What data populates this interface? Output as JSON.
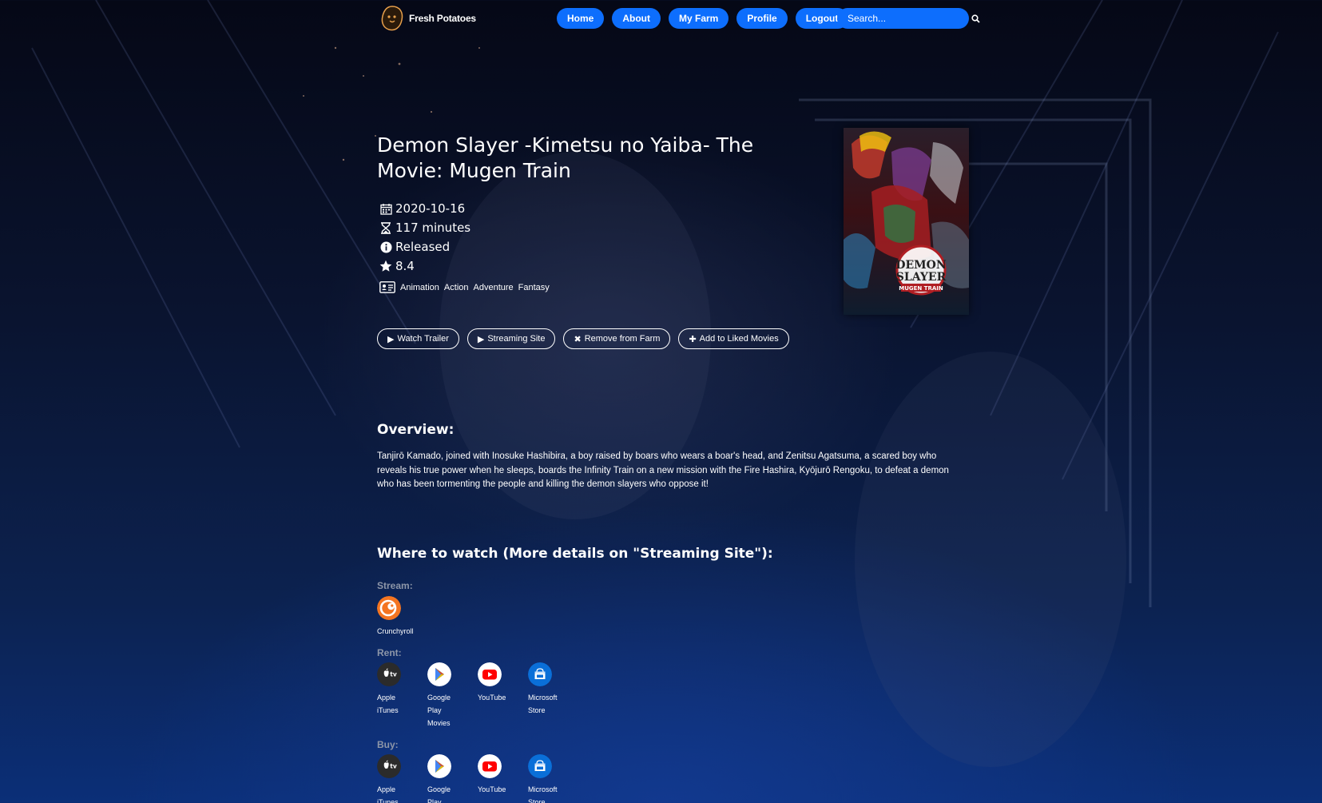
{
  "brand": {
    "name": "Fresh Potatoes",
    "icon": "potato-icon"
  },
  "nav": {
    "items": [
      "Home",
      "About",
      "My Farm",
      "Profile",
      "Logout"
    ],
    "search_placeholder": "Search..."
  },
  "movie": {
    "title": "Demon Slayer -Kimetsu no Yaiba- The Movie: Mugen Train",
    "release_date": "2020-10-16",
    "runtime": "117 minutes",
    "status": "Released",
    "rating": "8.4",
    "genres": [
      "Animation",
      "Action",
      "Adventure",
      "Fantasy"
    ],
    "poster": {
      "title_line1": "DEMON",
      "title_line2": "SLAYER",
      "subtitle": "MUGEN TRAIN"
    }
  },
  "actions": {
    "watch_trailer": "Watch Trailer",
    "streaming_site": "Streaming Site",
    "remove_from_farm": "Remove from Farm",
    "add_to_liked": "Add to Liked Movies"
  },
  "overview": {
    "heading": "Overview:",
    "text": "Tanjirō Kamado, joined with Inosuke Hashibira, a boy raised by boars who wears a boar's head, and Zenitsu Agatsuma, a scared boy who reveals his true power when he sleeps, boards the Infinity Train on a new mission with the Fire Hashira, Kyōjurō Rengoku, to defeat a demon who has been tormenting the people and killing the demon slayers who oppose it!"
  },
  "where_to_watch": {
    "heading": "Where to watch (More details on \"Streaming Site\"):",
    "stream_label": "Stream:",
    "stream": [
      {
        "name": "Crunchyroll",
        "icon": "crunchyroll-icon"
      }
    ],
    "rent_label": "Rent:",
    "rent": [
      {
        "name": "Apple iTunes",
        "icon": "apple-tv-icon"
      },
      {
        "name": "Google Play Movies",
        "icon": "google-play-icon"
      },
      {
        "name": "YouTube",
        "icon": "youtube-icon"
      },
      {
        "name": "Microsoft Store",
        "icon": "microsoft-store-icon"
      }
    ],
    "buy_label": "Buy:",
    "buy": [
      {
        "name": "Apple iTunes",
        "icon": "apple-tv-icon"
      },
      {
        "name": "Google Play Movies",
        "icon": "google-play-icon"
      },
      {
        "name": "YouTube",
        "icon": "youtube-icon"
      },
      {
        "name": "Microsoft Store",
        "icon": "microsoft-store-icon"
      }
    ]
  },
  "colors": {
    "accent": "#0d6efd",
    "label_gray": "#8d96a8"
  }
}
